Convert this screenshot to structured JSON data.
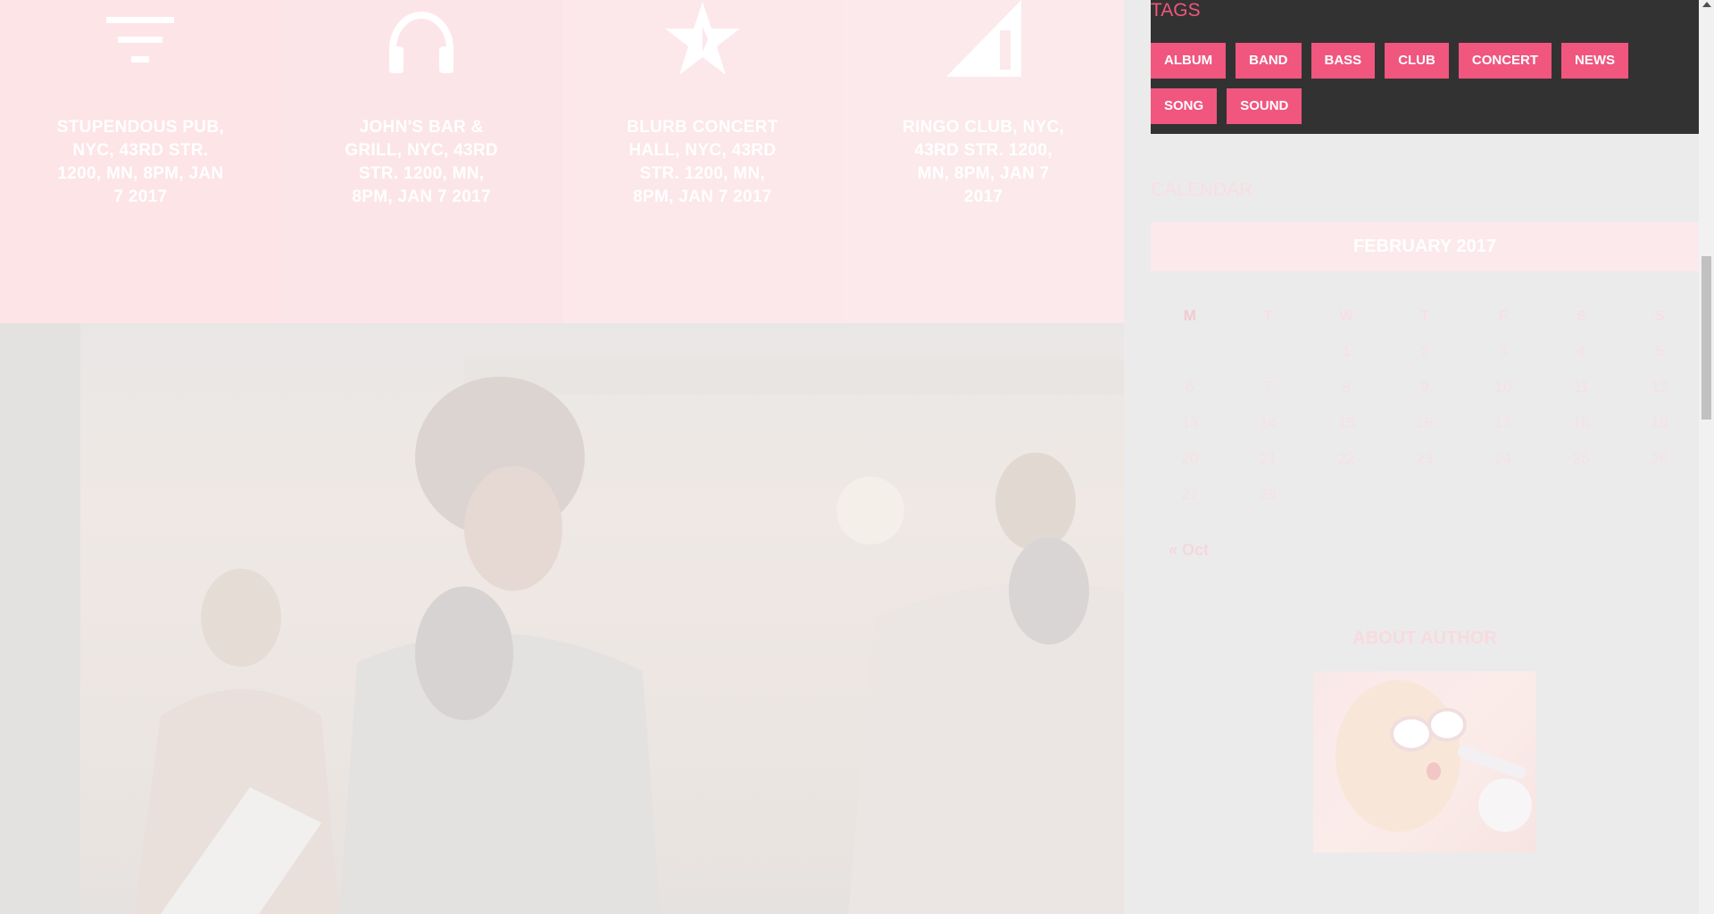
{
  "events": [
    {
      "icon": "filter-icon",
      "text": "STUPENDOUS PUB, NYC, 43RD STR. 1200, MN, 8PM, JAN 7 2017"
    },
    {
      "icon": "headphones-icon",
      "text": "JOHN'S BAR & GRILL, NYC, 43RD STR. 1200, MN, 8PM, JAN 7 2017"
    },
    {
      "icon": "star-icon",
      "text": "BLURB CONCERT HALL, NYC, 43RD STR. 1200, MN, 8PM, JAN 7 2017"
    },
    {
      "icon": "signal-icon",
      "text": "RINGO CLUB, NYC, 43RD STR. 1200, MN, 8PM, JAN 7 2017"
    }
  ],
  "band_photo": {
    "icon": "band-photo-image"
  },
  "sidebar": {
    "tags": {
      "title": "TAGS",
      "items": [
        "ALBUM",
        "BAND",
        "BASS",
        "CLUB",
        "CONCERT",
        "NEWS",
        "SONG",
        "SOUND"
      ]
    },
    "calendar": {
      "title": "CALENDAR",
      "month": "FEBRUARY 2017",
      "weekdays": [
        "M",
        "T",
        "W",
        "T",
        "F",
        "S",
        "S"
      ],
      "weeks": [
        [
          "",
          "",
          "1",
          "2",
          "3",
          "4",
          "5"
        ],
        [
          "6",
          "7",
          "8",
          "9",
          "10",
          "11",
          "12"
        ],
        [
          "13",
          "14",
          "15",
          "16",
          "17",
          "18",
          "19"
        ],
        [
          "20",
          "21",
          "22",
          "23",
          "24",
          "25",
          "26"
        ],
        [
          "27",
          "28",
          "",
          "",
          "",
          "",
          ""
        ]
      ],
      "prev_link": "« Oct"
    },
    "author": {
      "title": "ABOUT AUTHOR",
      "icon": "author-photo-image"
    }
  },
  "colors": {
    "accent": "#f0567e",
    "dark_panel": "#323232",
    "page_bg": "#ebebeb"
  }
}
